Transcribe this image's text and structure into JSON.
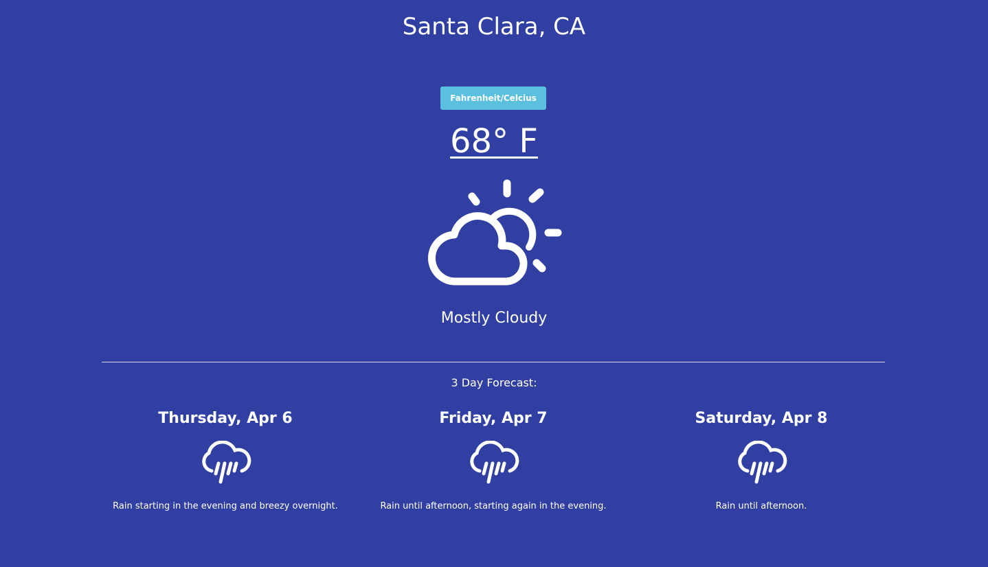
{
  "location": "Santa Clara, CA",
  "unit_toggle_label": "Fahrenheit/Celcius",
  "current": {
    "temperature": "68° F",
    "icon": "partly-cloudy-day-icon",
    "summary": "Mostly Cloudy"
  },
  "forecast": {
    "title": "3 Day Forecast:",
    "days": [
      {
        "name": "Thursday, Apr 6",
        "icon": "rain-icon",
        "description": "Rain starting in the evening and breezy overnight."
      },
      {
        "name": "Friday, Apr 7",
        "icon": "rain-icon",
        "description": "Rain until afternoon, starting again in the evening."
      },
      {
        "name": "Saturday, Apr 8",
        "icon": "rain-icon",
        "description": "Rain until afternoon."
      }
    ]
  },
  "colors": {
    "background": "#303fa1",
    "button": "#5bc0de",
    "text": "#ffffff"
  }
}
